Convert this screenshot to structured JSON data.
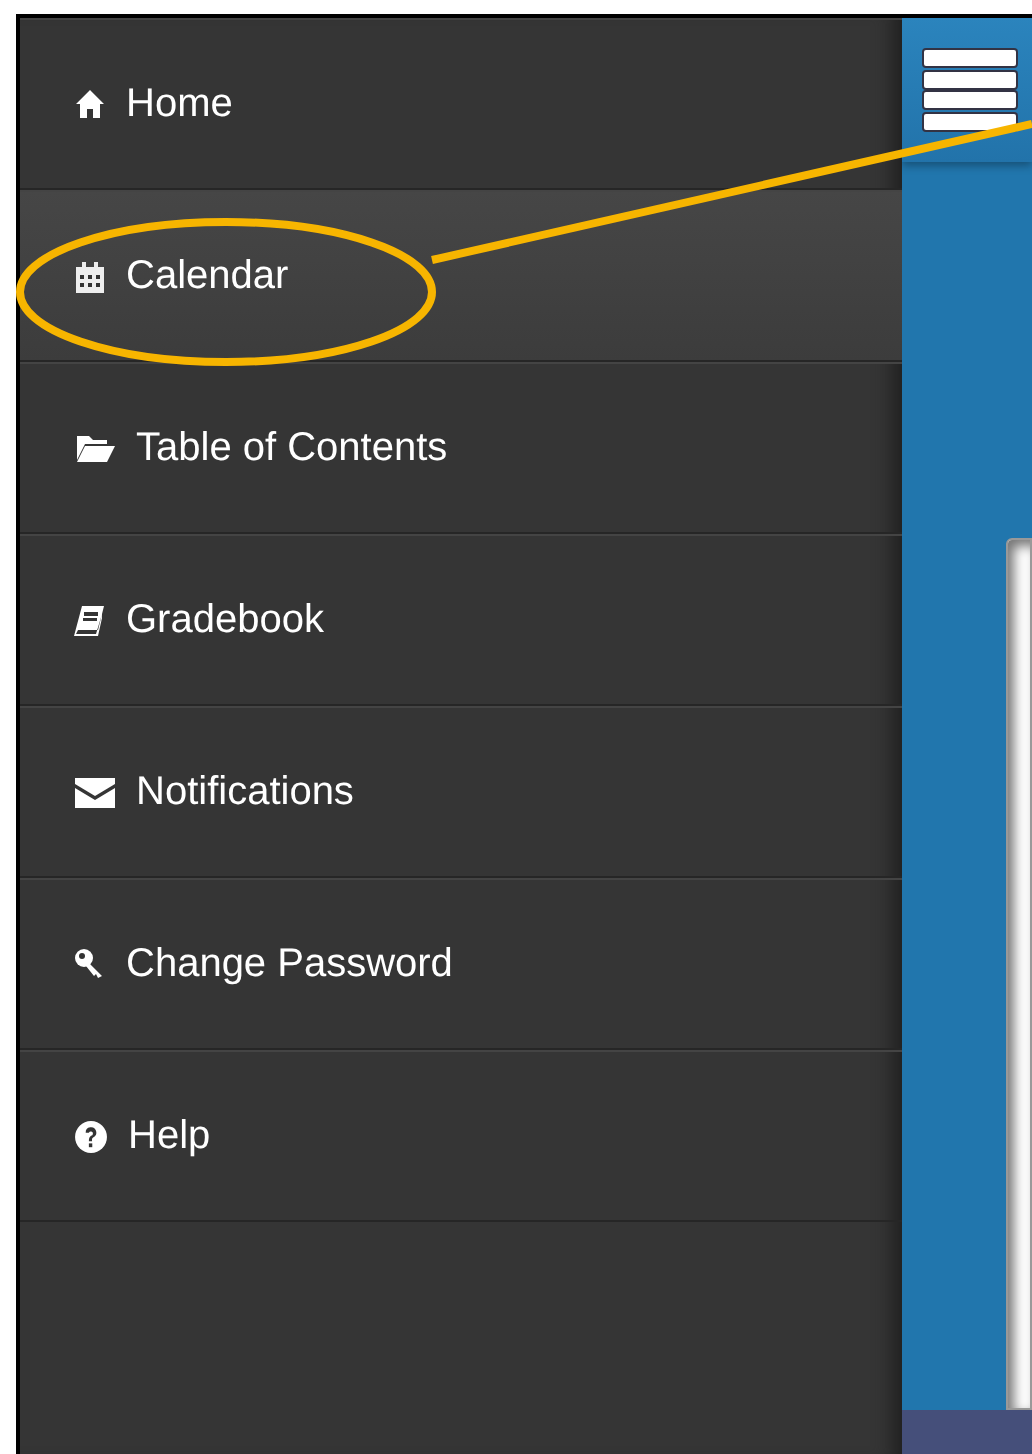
{
  "sidebar": {
    "items": [
      {
        "label": "Home",
        "selected": false
      },
      {
        "label": "Calendar",
        "selected": true
      },
      {
        "label": "Table of Contents",
        "selected": false
      },
      {
        "label": "Gradebook",
        "selected": false
      },
      {
        "label": "Notifications",
        "selected": false
      },
      {
        "label": "Change Password",
        "selected": false
      },
      {
        "label": "Help",
        "selected": false
      }
    ]
  }
}
